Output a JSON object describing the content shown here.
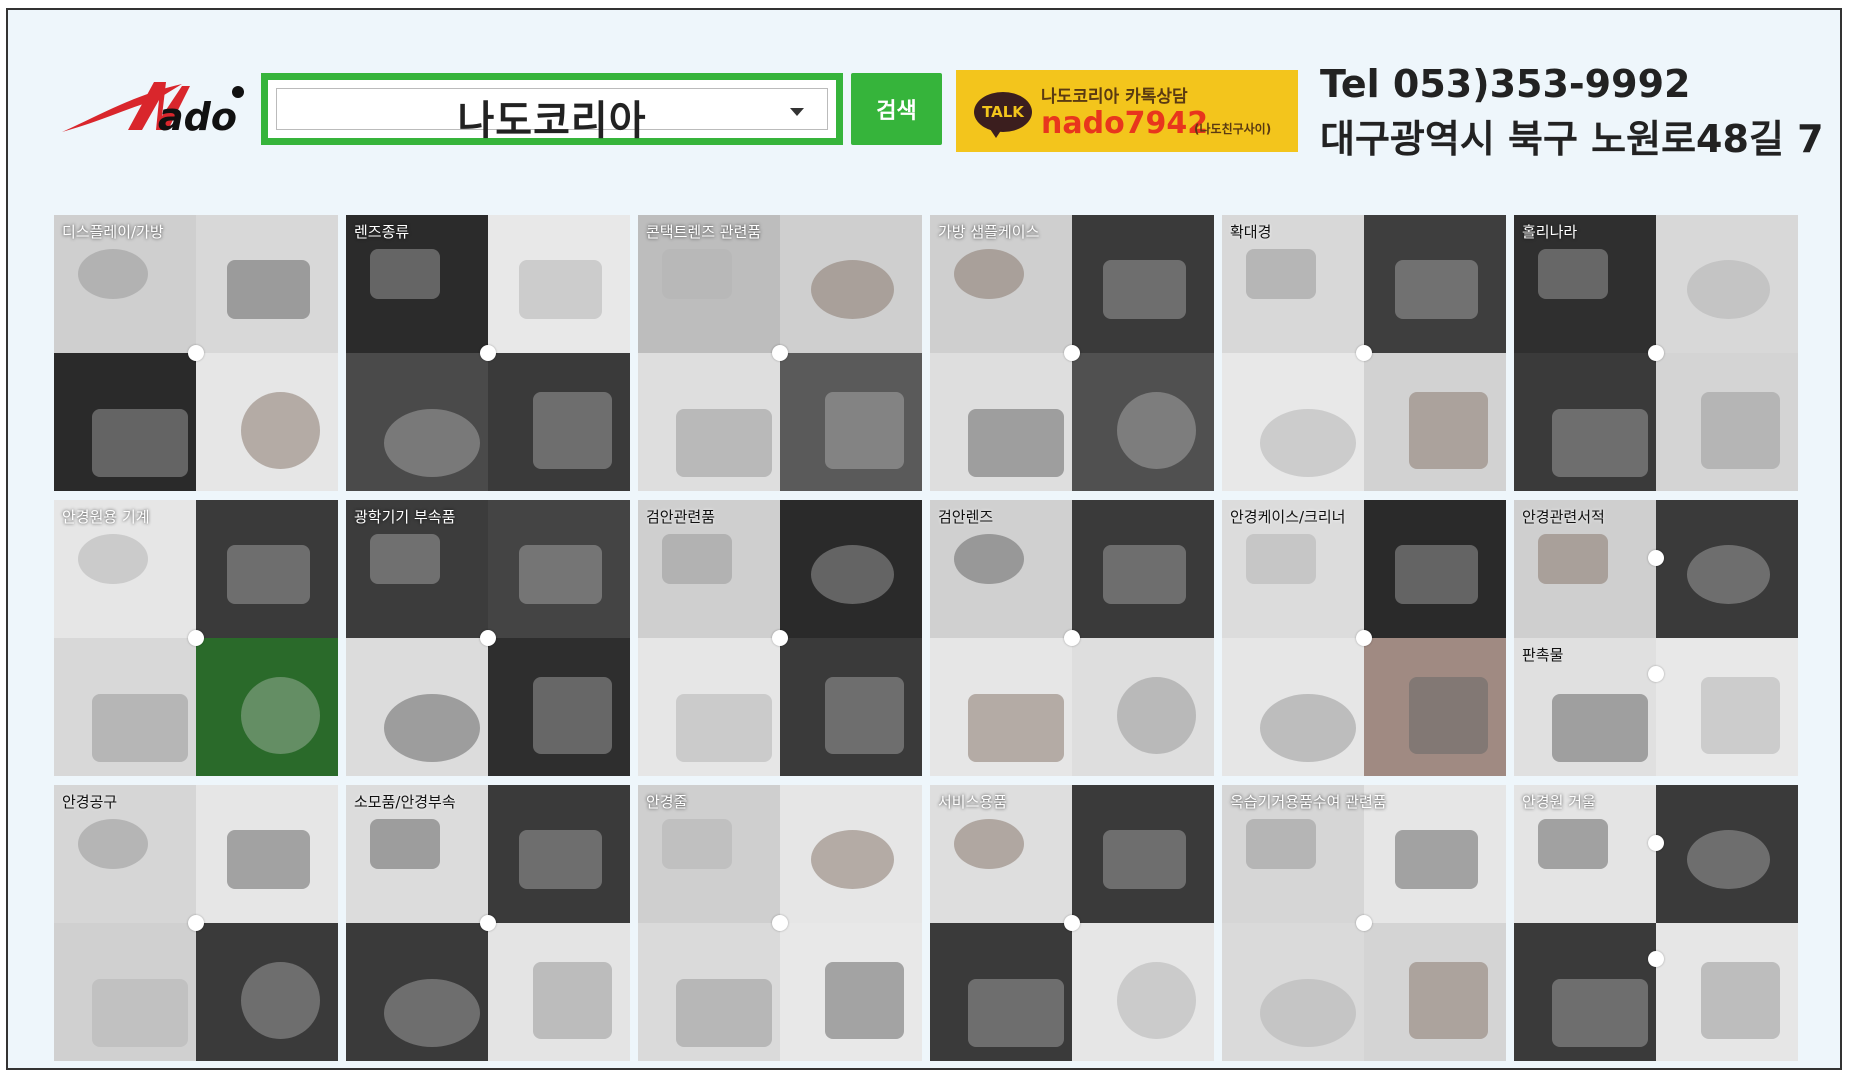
{
  "header": {
    "logo_text": "Nado",
    "search": {
      "value": "나도코리아",
      "button_label": "검색"
    },
    "kakao": {
      "badge": "TALK",
      "title": "나도코리아 카톡상담",
      "id": "nado7942",
      "note": "(나도친구사이)"
    },
    "contact": {
      "tel": "Tel 053)353-9992",
      "address": "대구광역시 북구 노원로48길 7"
    }
  },
  "categories": [
    {
      "label": "디스플레이/가방",
      "label_color": "#ffffff",
      "dot_pos": "center",
      "tiles": [
        "#cfcfcf",
        "#d8d8d8",
        "#2a2a2a",
        "#e6e6e6"
      ]
    },
    {
      "label": "렌즈종류",
      "label_color": "#ffffff",
      "dot_pos": "center",
      "tiles": [
        "#2b2b2b",
        "#e8e8e8",
        "#4a4a4a",
        "#3a3a3a"
      ]
    },
    {
      "label": "콘택트렌즈 관련품",
      "label_color": "#ffffff",
      "dot_pos": "center",
      "tiles": [
        "#bdbdbd",
        "#cfcfcf",
        "#dedede",
        "#5a5a5a"
      ]
    },
    {
      "label": "가방 샘플케이스",
      "label_color": "#ffffff",
      "dot_pos": "center",
      "tiles": [
        "#cfcfcf",
        "#3a3a3a",
        "#dedede",
        "#505050"
      ]
    },
    {
      "label": "확대경",
      "label_color": "#111111",
      "dot_pos": "center",
      "tiles": [
        "#d8d8d8",
        "#3e3e3e",
        "#e8e8e8",
        "#d2d2d2"
      ]
    },
    {
      "label": "홀리나라",
      "label_color": "#ffffff",
      "dot_pos": "center",
      "tiles": [
        "#2f2f2f",
        "#d8d8d8",
        "#3a3a3a",
        "#d4d4d4"
      ]
    },
    {
      "label": "안경원용 기계",
      "label_color": "#ffffff",
      "dot_pos": "center",
      "tiles": [
        "#e6e6e6",
        "#3a3a3a",
        "#d8d8d8",
        "#2a6a2a"
      ]
    },
    {
      "label": "광학기기 부속품",
      "label_color": "#ffffff",
      "dot_pos": "center",
      "tiles": [
        "#3c3c3c",
        "#444444",
        "#dcdcdc",
        "#2e2e2e"
      ]
    },
    {
      "label": "검안관련품",
      "label_color": "#111111",
      "dot_pos": "center",
      "tiles": [
        "#cfcfcf",
        "#2a2a2a",
        "#e6e6e6",
        "#3a3a3a"
      ]
    },
    {
      "label": "검안렌즈",
      "label_color": "#111111",
      "dot_pos": "center",
      "tiles": [
        "#d0d0d0",
        "#3a3a3a",
        "#e6e6e6",
        "#dedede"
      ]
    },
    {
      "label": "안경케이스/크리너",
      "label_color": "#111111",
      "dot_pos": "center",
      "tiles": [
        "#dcdcdc",
        "#2a2a2a",
        "#e6e6e6",
        "#a08a82"
      ]
    },
    {
      "label": "안경관련서적",
      "label_color": "#111111",
      "dot_pos": "right",
      "tiles": [
        "#cfcfcf",
        "#3a3a3a",
        "#e0e0e0",
        "#e8e8e8"
      ]
    },
    {
      "label": "안경공구",
      "label_color": "#111111",
      "dot_pos": "center",
      "tiles": [
        "#d6d6d6",
        "#e6e6e6",
        "#d0d0d0",
        "#3a3a3a"
      ]
    },
    {
      "label": "소모품/안경부속",
      "label_color": "#111111",
      "dot_pos": "center",
      "tiles": [
        "#dcdcdc",
        "#3a3a3a",
        "#3a3a3a",
        "#e4e4e4"
      ]
    },
    {
      "label": "안경줄",
      "label_color": "#ffffff",
      "dot_pos": "center",
      "tiles": [
        "#cfcfcf",
        "#e6e6e6",
        "#dadada",
        "#e8e8e8"
      ]
    },
    {
      "label": "서비스용품",
      "label_color": "#ffffff",
      "dot_pos": "center",
      "tiles": [
        "#dedede",
        "#3a3a3a",
        "#3a3a3a",
        "#e6e6e6"
      ]
    },
    {
      "label": "옥습기거용품수여 관련품",
      "label_color": "#ffffff",
      "dot_pos": "center",
      "tiles": [
        "#d6d6d6",
        "#e6e6e6",
        "#dadada",
        "#d4d4d4"
      ]
    },
    {
      "label": "안경원 거울",
      "label_color": "#ffffff",
      "dot_pos": "right",
      "tiles": [
        "#e4e4e4",
        "#3a3a3a",
        "#3a3a3a",
        "#e6e6e6"
      ]
    }
  ],
  "extra_labels": {
    "panchok": "판촉물"
  }
}
